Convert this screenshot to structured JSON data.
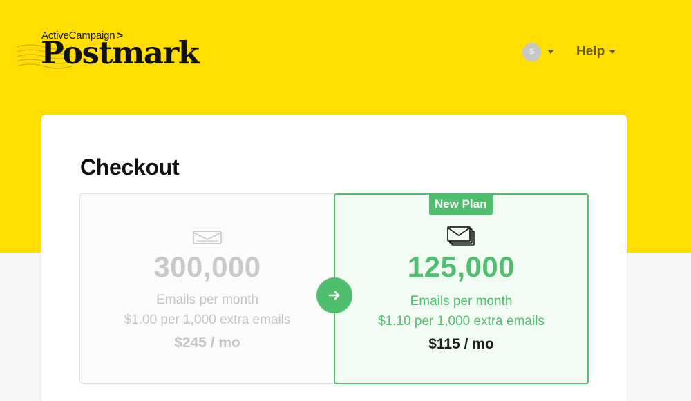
{
  "brand": {
    "parent_label": "ActiveCampaign",
    "parent_chevron": ">",
    "wordmark": "Postmark",
    "accent_color": "#ffde00"
  },
  "header": {
    "user_initial": "S",
    "help_label": "Help"
  },
  "checkout": {
    "title": "Checkout",
    "current_plan": {
      "icon": "single-envelope-icon",
      "emails": "300,000",
      "unit_label": "Emails per month",
      "extra_rate": "$1.00 per 1,000 extra emails",
      "price": "$245 / mo"
    },
    "new_plan": {
      "badge": "New Plan",
      "icon": "stacked-envelopes-icon",
      "emails": "125,000",
      "unit_label": "Emails per month",
      "extra_rate": "$1.10 per 1,000 extra emails",
      "price": "$115 / mo",
      "accent_color": "#4fbf6f"
    },
    "arrow_icon": "arrow-right-icon"
  }
}
